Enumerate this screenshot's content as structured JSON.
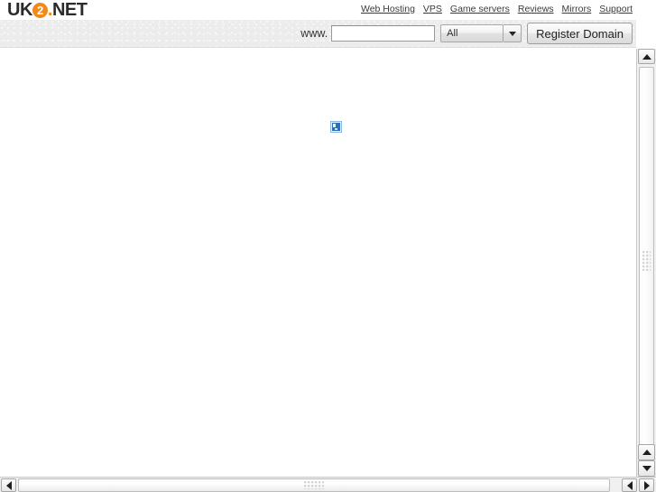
{
  "brand": {
    "logo_prefix": "UK",
    "logo_circle": "2",
    "logo_dot": ".",
    "logo_suffix": "NET",
    "accent_color": "#f08a1c",
    "text_color": "#2b2b2b"
  },
  "topnav": {
    "items": [
      {
        "label": "Web Hosting"
      },
      {
        "label": "VPS"
      },
      {
        "label": "Game servers"
      },
      {
        "label": "Reviews"
      },
      {
        "label": "Mirrors"
      },
      {
        "label": "Support"
      }
    ]
  },
  "searchbar": {
    "www_label": "www.",
    "domain_value": "",
    "domain_placeholder": "",
    "tld_selected": "All",
    "tld_options": [
      "All"
    ],
    "register_label": "Register Domain",
    "dropdown_icon": "chevron-down-icon"
  },
  "content": {
    "broken_image_icon": "broken-image-icon"
  },
  "scrollbars": {
    "vertical": {
      "up_icon": "arrow-up-icon",
      "down_icon": "arrow-down-icon",
      "thumb_grip": "grip-dots"
    },
    "horizontal": {
      "left_icon": "arrow-left-icon",
      "right_icon": "arrow-right-icon",
      "thumb_grip": "grip-dots"
    }
  }
}
